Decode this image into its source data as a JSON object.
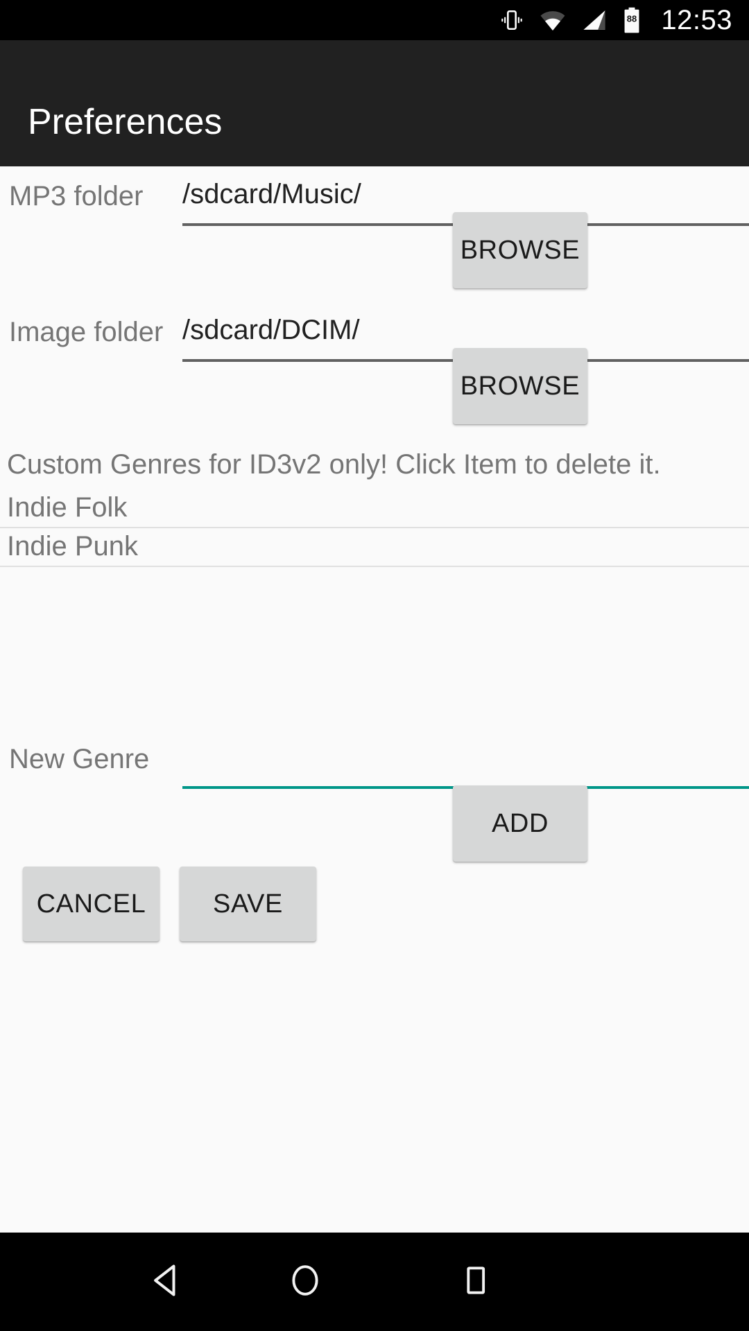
{
  "status_bar": {
    "time": "12:53",
    "battery_level": "88",
    "icons": [
      "vibrate-icon",
      "wifi-icon",
      "cellular-signal-icon",
      "battery-icon"
    ]
  },
  "app_bar": {
    "title": "Preferences"
  },
  "form": {
    "mp3_folder": {
      "label": "MP3 folder",
      "value": "/sdcard/Music/",
      "browse_label": "BROWSE"
    },
    "image_folder": {
      "label": "Image folder",
      "value": "/sdcard/DCIM/",
      "browse_label": "BROWSE"
    }
  },
  "genres": {
    "note": "Custom Genres for ID3v2 only! Click Item to delete it.",
    "items": [
      {
        "name": "Indie Folk"
      },
      {
        "name": "Indie Punk"
      }
    ],
    "new_genre": {
      "label": "New Genre",
      "value": "",
      "placeholder": "",
      "add_label": "ADD"
    }
  },
  "actions": {
    "cancel_label": "CANCEL",
    "save_label": "SAVE"
  },
  "nav_bar": {
    "back": "back-icon",
    "home": "home-icon",
    "recents": "recents-icon"
  },
  "colors": {
    "accent": "#009688",
    "app_bar": "#212121",
    "background": "#fafafa",
    "button": "#d6d7d7",
    "label_text": "#757575",
    "value_text": "#212121"
  }
}
